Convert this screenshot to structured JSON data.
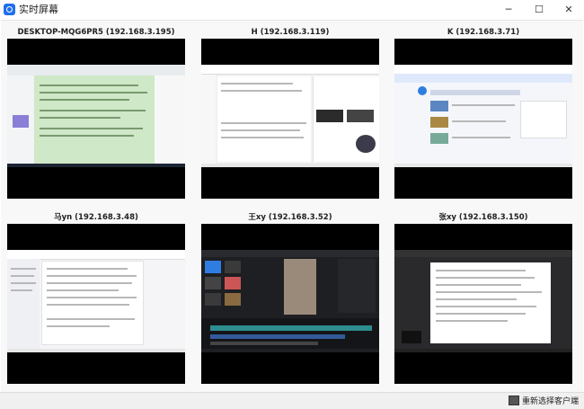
{
  "window": {
    "title": "实时屏幕",
    "minimize": "─",
    "maximize": "☐",
    "close": "✕"
  },
  "clients": [
    {
      "name": "DESKTOP-MQG6PR5 (192.168.3.195)",
      "preview": "document-editor"
    },
    {
      "name": "H (192.168.3.119)",
      "preview": "document-page"
    },
    {
      "name": "K (192.168.3.71)",
      "preview": "browser-feed"
    },
    {
      "name": "马yn (192.168.3.48)",
      "preview": "chat-document"
    },
    {
      "name": "王xy (192.168.3.52)",
      "preview": "video-editor"
    },
    {
      "name": "张xy (192.168.3.150)",
      "preview": "dark-document"
    }
  ],
  "footer": {
    "reselect_label": "重新选择客户端"
  }
}
